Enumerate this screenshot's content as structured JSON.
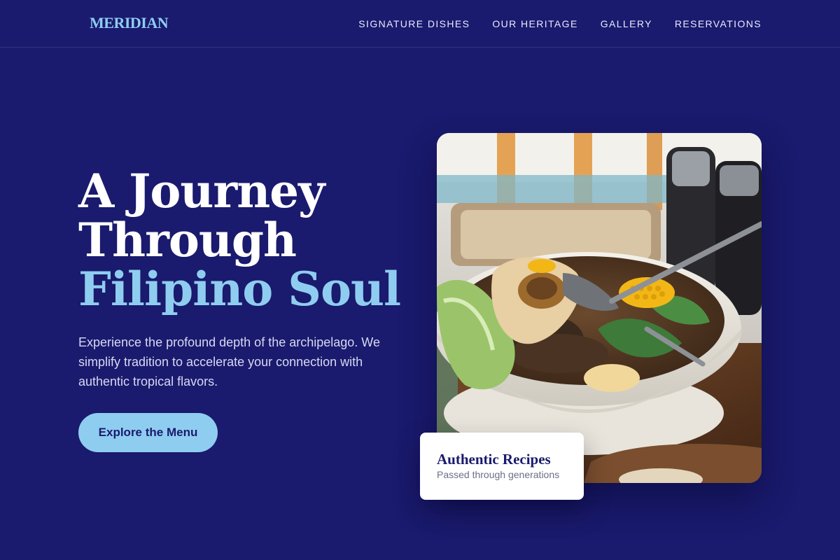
{
  "brand": {
    "logo": "MERIDIAN"
  },
  "nav": {
    "items": [
      {
        "label": "SIGNATURE DISHES"
      },
      {
        "label": "OUR HERITAGE"
      },
      {
        "label": "GALLERY"
      },
      {
        "label": "RESERVATIONS"
      }
    ]
  },
  "hero": {
    "title_line1": "A Journey",
    "title_line2": "Through",
    "title_accent": "Filipino Soul",
    "subtitle": "Experience the profound depth of the archipelago. We simplify tradition to accelerate your connection with authentic tropical flavors.",
    "cta_label": "Explore the Menu"
  },
  "feature_card": {
    "title": "Authentic Recipes",
    "subtitle": "Passed through generations"
  },
  "photo": {
    "alt": "Bowl of bulalo soup with bone marrow, corn and greens"
  },
  "colors": {
    "background": "#1a1a6e",
    "accent": "#8fcdf0",
    "card_bg": "#ffffff",
    "text_muted": "#d6d9f2"
  }
}
